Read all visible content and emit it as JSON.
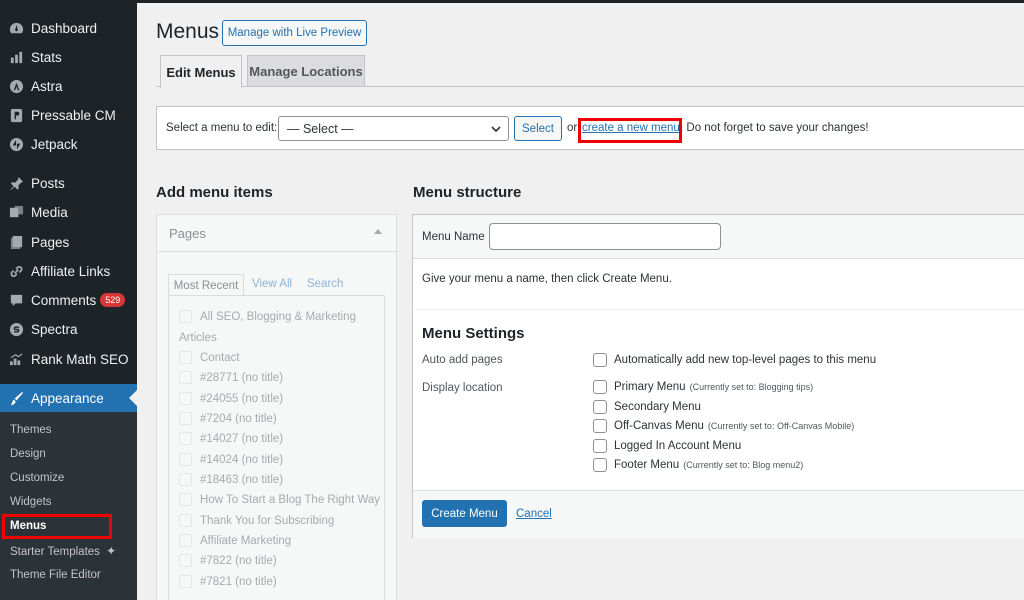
{
  "sidebar": {
    "items": [
      {
        "label": "Dashboard",
        "icon": "dashboard-icon"
      },
      {
        "label": "Stats",
        "icon": "stats-icon"
      },
      {
        "label": "Astra",
        "icon": "astra-icon"
      },
      {
        "label": "Pressable CM",
        "icon": "pressable-icon"
      },
      {
        "label": "Jetpack",
        "icon": "jetpack-icon"
      },
      {
        "label": "Posts",
        "icon": "pin-icon"
      },
      {
        "label": "Media",
        "icon": "media-icon"
      },
      {
        "label": "Pages",
        "icon": "pages-icon"
      },
      {
        "label": "Affiliate Links",
        "icon": "link-icon"
      },
      {
        "label": "Comments",
        "icon": "comments-icon",
        "badge": "529"
      },
      {
        "label": "Spectra",
        "icon": "spectra-icon"
      },
      {
        "label": "Rank Math SEO",
        "icon": "rankmath-icon"
      },
      {
        "label": "Appearance",
        "icon": "brush-icon"
      }
    ],
    "submenu": [
      "Themes",
      "Design",
      "Customize",
      "Widgets",
      "Menus",
      "Starter Templates",
      "Theme File Editor"
    ]
  },
  "header": {
    "title": "Menus",
    "live_preview": "Manage with Live Preview",
    "tabs": [
      "Edit Menus",
      "Manage Locations"
    ]
  },
  "select_bar": {
    "label": "Select a menu to edit:",
    "dropdown_value": "— Select —",
    "select_button": "Select",
    "or": "or",
    "create_link": "create a new menu",
    "save_text": ". Do not forget to save your changes!"
  },
  "add_items": {
    "heading": "Add menu items",
    "panel_title": "Pages",
    "tabs": [
      "Most Recent",
      "View All",
      "Search"
    ],
    "list": [
      {
        "type": "item",
        "label": "All SEO, Blogging & Marketing"
      },
      {
        "type": "group",
        "label": "Articles"
      },
      {
        "type": "item",
        "label": "Contact"
      },
      {
        "type": "item",
        "label": "#28771 (no title)"
      },
      {
        "type": "item",
        "label": "#24055 (no title)"
      },
      {
        "type": "item",
        "label": "#7204 (no title)"
      },
      {
        "type": "item",
        "label": "#14027 (no title)"
      },
      {
        "type": "item",
        "label": "#14024 (no title)"
      },
      {
        "type": "item",
        "label": "#18463 (no title)"
      },
      {
        "type": "item",
        "label": "How To Start a Blog The Right Way"
      },
      {
        "type": "item",
        "label": "Thank You for Subscribing"
      },
      {
        "type": "item",
        "label": "Affiliate Marketing"
      },
      {
        "type": "item",
        "label": "#7822 (no title)"
      },
      {
        "type": "item",
        "label": "#7821 (no title)"
      }
    ]
  },
  "structure": {
    "heading": "Menu structure",
    "name_label": "Menu Name",
    "name_value": "",
    "hint": "Give your menu a name, then click Create Menu.",
    "settings_heading": "Menu Settings",
    "auto_add_label": "Auto add pages",
    "auto_add_option": "Automatically add new top-level pages to this menu",
    "display_location_label": "Display location",
    "locations": [
      {
        "name": "Primary Menu",
        "note": "(Currently set to: Blogging tips)"
      },
      {
        "name": "Secondary Menu",
        "note": ""
      },
      {
        "name": "Off-Canvas Menu",
        "note": "(Currently set to: Off-Canvas Mobile)"
      },
      {
        "name": "Logged In Account Menu",
        "note": ""
      },
      {
        "name": "Footer Menu",
        "note": "(Currently set to: Blog menu2)"
      }
    ],
    "create_button": "Create Menu",
    "cancel": "Cancel"
  },
  "colors": {
    "sidebar_bg": "#1d2327",
    "accent": "#2271b1",
    "highlight": "#ee0000",
    "badge": "#d63638"
  }
}
